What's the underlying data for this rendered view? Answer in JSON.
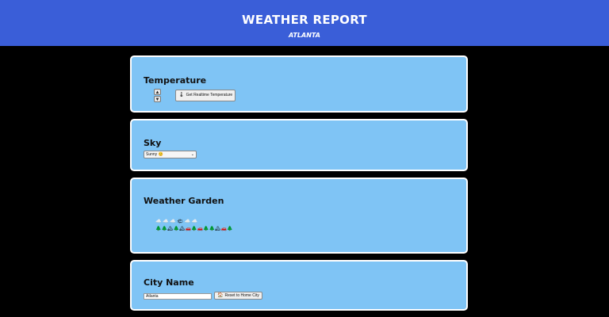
{
  "header": {
    "title": "WEATHER REPORT",
    "city": "ATLANTA"
  },
  "temperature": {
    "heading": "Temperature",
    "up_icon": "arrow-up-icon",
    "down_icon": "arrow-down-icon",
    "realtime_button": "Get Realtime Temperature",
    "realtime_icon": "thermometer-icon"
  },
  "sky": {
    "heading": "Sky",
    "selected": "Sunny 😊"
  },
  "garden": {
    "heading": "Weather Garden",
    "sky_row": "☁️ ☁️ ☁️ 🌤 ☁️ ☁️",
    "ground_row": "🌲🌲🏔🌲🏔🚗🌲🚗🌲🌲🏔🚗🌲"
  },
  "city": {
    "heading": "City Name",
    "input_value": "Atlanta",
    "reset_button": "Reset to Home City",
    "reset_icon": "home-icon"
  },
  "colors": {
    "header_bg": "#3a5ed8",
    "panel_bg": "#7fc4f5",
    "page_bg": "#000000"
  }
}
